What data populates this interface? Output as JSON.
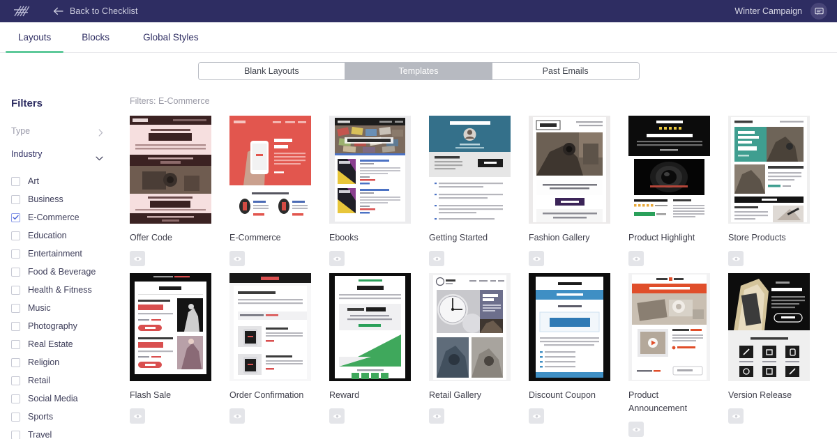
{
  "topbar": {
    "logo_icon": "brand-hash-logo",
    "back_icon": "arrow-left-icon",
    "back_label": "Back to Checklist",
    "campaign_name": "Winter Campaign",
    "chat_icon": "chat-bubble-icon",
    "bg_color": "#2e2d62"
  },
  "nav": {
    "tabs": [
      {
        "label": "Layouts",
        "active": true
      },
      {
        "label": "Blocks",
        "active": false
      },
      {
        "label": "Global Styles",
        "active": false
      }
    ],
    "active_underline_color": "#5ec99a"
  },
  "segmented": {
    "options": [
      {
        "label": "Blank Layouts",
        "active": false
      },
      {
        "label": "Templates",
        "active": true
      },
      {
        "label": "Past Emails",
        "active": false
      }
    ],
    "active_bg": "#b7bac1"
  },
  "sidebar": {
    "title": "Filters",
    "groups": [
      {
        "label": "Type",
        "expanded": false,
        "icon": "chevron-right-icon"
      },
      {
        "label": "Industry",
        "expanded": true,
        "icon": "chevron-down-icon"
      }
    ],
    "industry_options": [
      {
        "label": "Art",
        "checked": false
      },
      {
        "label": "Business",
        "checked": false
      },
      {
        "label": "E-Commerce",
        "checked": true
      },
      {
        "label": "Education",
        "checked": false
      },
      {
        "label": "Entertainment",
        "checked": false
      },
      {
        "label": "Food & Beverage",
        "checked": false
      },
      {
        "label": "Health & Fitness",
        "checked": false
      },
      {
        "label": "Music",
        "checked": false
      },
      {
        "label": "Photography",
        "checked": false
      },
      {
        "label": "Real Estate",
        "checked": false
      },
      {
        "label": "Religion",
        "checked": false
      },
      {
        "label": "Retail",
        "checked": false
      },
      {
        "label": "Social Media",
        "checked": false
      },
      {
        "label": "Sports",
        "checked": false
      },
      {
        "label": "Travel",
        "checked": false
      }
    ],
    "checked_color": "#4b63d8"
  },
  "main": {
    "filters_applied": "Filters: E-Commerce",
    "preview_icon": "eye-icon",
    "templates_row1": [
      {
        "title": "Offer Code"
      },
      {
        "title": "E-Commerce"
      },
      {
        "title": "Ebooks"
      },
      {
        "title": "Getting Started"
      },
      {
        "title": "Fashion Gallery"
      },
      {
        "title": "Product Highlight"
      },
      {
        "title": "Store Products"
      }
    ],
    "templates_row2": [
      {
        "title": "Flash Sale"
      },
      {
        "title": "Order Confirmation"
      },
      {
        "title": "Reward"
      },
      {
        "title": "Retail Gallery"
      },
      {
        "title": "Discount Coupon"
      },
      {
        "title": "Product Announcement"
      },
      {
        "title": "Version Release"
      }
    ],
    "thumb_text": {
      "offer_code_brand": "CANTERLY",
      "offer_code_head": "FROM US TO YOU",
      "offer_code_big": "30% OFF",
      "offer_code_sub": "SINGLE PURCHASE COUPON",
      "offer_code_big2": "10% OFF",
      "ecom_price": "$499.00",
      "ecom_sale": "FOR SALE!",
      "ecom_offers": "CHECK OUT OUR LATEST OFFERS",
      "ebooks_brand": "x-Ebooks",
      "ebooks_hero": "x-Ebooks.eu",
      "getting_started_head": "Welcome to Our Company",
      "getting_started_sub": "Get Started with Us!",
      "fashion_brand": "Fashion",
      "fashion_footer": "We are proud to introduce you the best collections in fashion industry",
      "product_highlight_brand": "LATERAL SHOP",
      "product_highlight_head": "New Products are Online!",
      "product_highlight_price": "$598.00",
      "store_products_head": "New Products for Sale!",
      "store_products_off": "30% OFF",
      "store_products_item": "Fashion Winter Boots",
      "store_products_item2": "Makeup Tutorial",
      "flash_sale_save1": "SAVE 10%",
      "flash_sale_save2": "SAVE 15%",
      "order_head": "Thank you for your order!",
      "reward_head": "Congrats!",
      "reward_off": "You earned 50% OFF",
      "retail_gallery_brand": "Watch",
      "retail_gallery_head": "Guaranteed Accuracy",
      "discount_off": "40% OFF",
      "discount_sub": "WE'RE GIVING YOU",
      "product_ann_head": "Our New Product is Now Online!",
      "version_head": "New update available!",
      "version_sub": "What's New in Version 2.0?"
    }
  }
}
